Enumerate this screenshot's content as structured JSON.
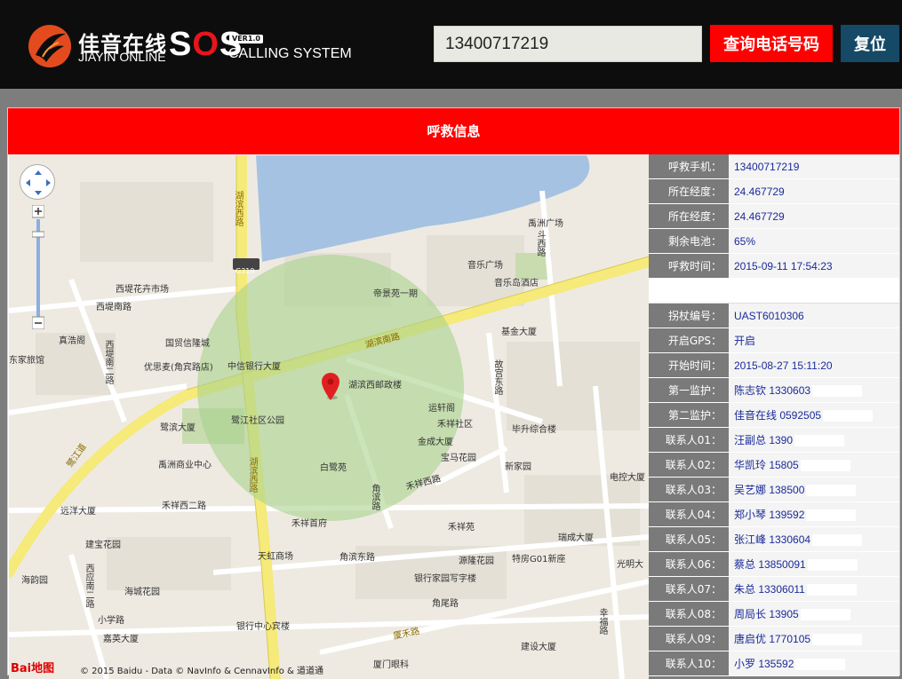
{
  "header": {
    "brand_cn": "佳音在线",
    "brand_en": "JIAYIN ONLINE",
    "sos_s1": "S",
    "sos_o": "O",
    "sos_s2": "S",
    "version": "VER1.0",
    "calling": "CALLING SYSTEM",
    "phone_value": "13400717219",
    "query_button": "查询电话号码",
    "reset_button": "复位"
  },
  "panel": {
    "title": "呼救信息"
  },
  "info_rows": [
    {
      "label": "呼救手机：",
      "value": "13400717219"
    },
    {
      "label": "所在经度：",
      "value": "24.467729"
    },
    {
      "label": "所在经度：",
      "value": "24.467729"
    },
    {
      "label": "剩余电池：",
      "value": "65%"
    },
    {
      "label": "呼救时间：",
      "value": "2015-09-11 17:54:23"
    },
    {
      "label": "",
      "value": ""
    },
    {
      "label": "拐杖编号：",
      "value": "UAST6010306"
    },
    {
      "label": "开启GPS：",
      "value": "开启"
    },
    {
      "label": "开始时间：",
      "value": "2015-08-27 15:11:20"
    },
    {
      "label": "第一监护：",
      "value": "陈志钦 1330603"
    },
    {
      "label": "第二监护：",
      "value": "佳音在线 0592505"
    },
    {
      "label": "联系人01：",
      "value": "汪副总 1390"
    },
    {
      "label": "联系人02：",
      "value": "华凯玲 15805"
    },
    {
      "label": "联系人03：",
      "value": "吴艺娜 138500"
    },
    {
      "label": "联系人04：",
      "value": "郑小琴 139592"
    },
    {
      "label": "联系人05：",
      "value": "张江峰 1330604"
    },
    {
      "label": "联系人06：",
      "value": "蔡总 13850091"
    },
    {
      "label": "联系人07：",
      "value": "朱总 13306011"
    },
    {
      "label": "联系人08：",
      "value": "周局长 13905"
    },
    {
      "label": "联系人09：",
      "value": "唐启优 1770105"
    },
    {
      "label": "联系人10：",
      "value": "小罗 135592"
    }
  ],
  "map": {
    "labels": {
      "l1": "湖滨西路",
      "l2": "西堤花卉市场",
      "l3": "西堤南路",
      "l4": "真浩阁",
      "l5": "国贸信隆城",
      "l6": "优思麦(角宾路店)",
      "l7": "中信银行大厦",
      "l8": "湖滨南路",
      "l9": "湖滨西邮政楼",
      "l10": "鹭滨大厦",
      "l11": "鹭江社区公园",
      "l12": "禹洲商业中心",
      "l13": "白鹭苑",
      "l14": "禹洲广场",
      "l15": "音乐广场",
      "l16": "音乐岛酒店",
      "l17": "帝景苑一期",
      "l18": "基金大厦",
      "l19": "运轩阁",
      "l20": "禾祥社区",
      "l21": "金成大厦",
      "l22": "宝马花园",
      "l23": "毕升综合楼",
      "l24": "新家园",
      "l25": "禾祥西路",
      "l26": "故宫东路",
      "l27": "禾祥西二路",
      "l28": "远洋大厦",
      "l29": "建宝花园",
      "l30": "天虹商场",
      "l31": "禾祥首府",
      "l32": "禾祥苑",
      "l33": "角滨东路",
      "l34": "源隆花园",
      "l35": "特房G01新座",
      "l36": "瑞成大厦",
      "l37": "海韵园",
      "l38": "海城花园",
      "l39": "小学路",
      "l40": "嘉英大厦",
      "l41": "银行中心宾楼",
      "l42": "银行家园写字楼",
      "l43": "角尾路",
      "l44": "厦禾路",
      "l45": "建设大厦",
      "l46": "厦门眼科",
      "l47": "光明大",
      "l48": "电控大厦",
      "l49": "斗西路",
      "l50": "鹭江道",
      "l51": "湖滨西路",
      "l52": "角滨路",
      "l53": "故宫东路",
      "l54": "西堤南二路",
      "l55": "G319",
      "l56": "东家旅馆",
      "l57": "远洋大厦",
      "l58": "幸福路",
      "l59": "西应南二路"
    },
    "baidu": "Bai地图",
    "copyright": "© 2015 Baidu - Data © NavInfo & CennavInfo & 道道通"
  },
  "colors": {
    "header_bg": "#0d0d0d",
    "query_button": "#ff0000",
    "reset_button": "#164966",
    "title_bar": "#ff0000",
    "label_bg": "#7a7a7a",
    "value_text": "#1a2a9a",
    "water": "#a5c2e2",
    "main_road": "#f5ea7a",
    "radius_circle": "#a9d28c",
    "marker": "#e02020"
  },
  "icons": {
    "logo": "phoenix-logo-icon",
    "marker": "map-pin-icon",
    "pan": "map-pan-icon",
    "zoom": "map-zoom-icon",
    "poi": "poi-icon"
  }
}
